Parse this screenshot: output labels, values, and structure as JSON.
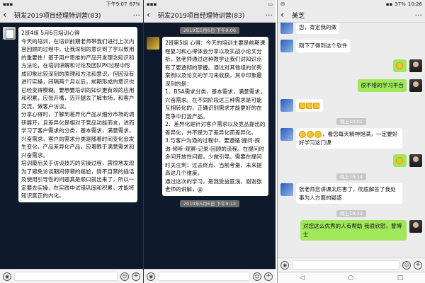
{
  "panel1": {
    "status": {
      "time": "下午9:07",
      "battery": "67%"
    },
    "title": "研发2019项目经理特训营(83)",
    "message": "2班4组 5月6日培训心得\n今天的培训，在培训前期老师带我们进行上次内容回顾的过程中，让我深刻的意识到了学以致用的重要性！基于用户思维的产品开发理念知识和方法论，在培训讲解和讨论及团队PK过程中形成印象比较深刻的原理和方法和意识，但因没有进行实操，间隔两个月以后，前期形成的意识也已经变得模糊。要想要培训的知识更有效的应用和积累，应张开嘴，迈开腿去了解市场，和客户交流，做客户访谈。\n分享心得时，了解到差异化产品从细分市场的调研展开，且差异化是相对于竞品功能而言，进而学习了客户需求的分类，基本需求，满意需求，兴奋需求，客户的需求分类是随着时间变化会发生变化，产品差异化产品，应着眼于满意需求和兴奋需求。\n培训最后关于访谈技巧的实操过程，震惊地发现为了避免访谈期间停顿的尴尬，情不自禁的插话及使用引导性的问题真是顺口就出来了，所以一定要去实操，在实践中试错巩固和积累，才能将知识真正的内化。"
  },
  "panel2": {
    "title": "研发2019项目经理特训营(83)",
    "timestamps": [
      "2019年5月6日 下午9:06",
      "2019年5月6日 下午9:13"
    ],
    "message": "2班第5组 心得：今天的培训主要是前期课程复习和心得体会分享以及实战小论文分析。张老师通过这种教学让我们对知识点有了更透彻的掌握。通过对其他组的优秀案例以及论文的学习来收获，其中印象最深刻的是：\n1、BSA需求分类，基本需求，满意需求，兴奋需求。在不同阶段这三种需求是可能互相转化的，正确识别需求才能更好的在竞争中打造产品。\n2、差异化是针对客户需求以及竞品提出的差异化，并不是为了差异化而差异化。\n3.与客户沟通的过程中，要遵循:提问-探询-倾听-观察-记录-回顾的流程。在提问时多问开放性问题，少做引导。需要在提问时关注到：过去终点、当前考量、未来提高这几个维度。\n通过这次的学习，是我受益匪浅，谢谢张老师的讲解，@"
  },
  "panel3": {
    "status": {
      "time": "10:26",
      "battery": "37%"
    },
    "title": "美芝",
    "partial_top": "您，肯定我的做",
    "msgs": [
      {
        "side": "left",
        "text": "刚下了得到这个软件"
      },
      {
        "side": "right",
        "emoji_count": 1
      },
      {
        "side": "right",
        "text": "很不错的学习平台"
      },
      {
        "side": "left",
        "thumbs": 3
      },
      {
        "side": "time",
        "text": "晚上10:01"
      },
      {
        "side": "left",
        "text": "，看您每天精神饱满，一定要好好学习这门课",
        "emoji_count": 3
      },
      {
        "side": "right",
        "emoji_count": 1
      },
      {
        "side": "time",
        "text": "晚上10:14"
      },
      {
        "side": "left",
        "text": "张老师您讲课太厉害了，彻底解答了我处事为人方面的疑惑"
      },
      {
        "side": "time",
        "text": "晚上10:22"
      },
      {
        "side": "right",
        "text": "对您这么优秀的人有帮助 我很欣慰，曹博士"
      }
    ],
    "nav": {
      "back": "◁",
      "home": "○",
      "recent": "□"
    }
  }
}
